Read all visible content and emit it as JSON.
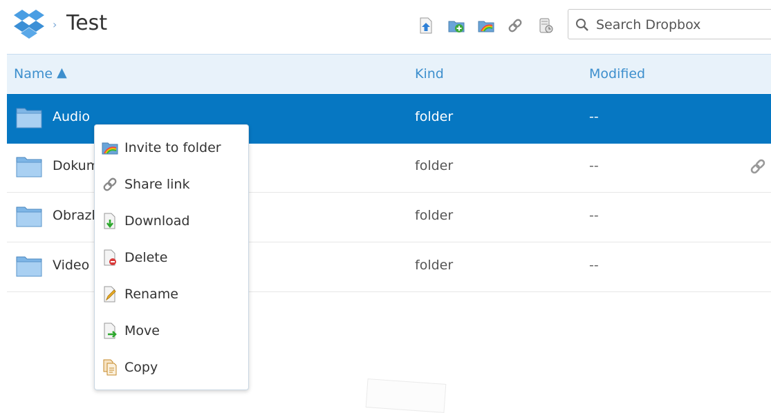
{
  "breadcrumb": {
    "arrow": "›",
    "title": "Test"
  },
  "search": {
    "placeholder": "Search Dropbox"
  },
  "columns": {
    "name": "Name",
    "sort": "▲",
    "kind": "Kind",
    "modified": "Modified"
  },
  "rows": [
    {
      "name": "Audio",
      "kind": "folder",
      "modified": "--"
    },
    {
      "name": "Dokumenty",
      "kind": "folder",
      "modified": "--"
    },
    {
      "name": "Obrazki",
      "kind": "folder",
      "modified": "--"
    },
    {
      "name": "Video",
      "kind": "folder",
      "modified": "--"
    }
  ],
  "context_menu": {
    "items": [
      {
        "label": "Invite to folder",
        "icon": "rainbow-folder-icon"
      },
      {
        "label": "Share link",
        "icon": "link-icon"
      },
      {
        "label": "Download",
        "icon": "download-icon"
      },
      {
        "label": "Delete",
        "icon": "delete-icon"
      },
      {
        "label": "Rename",
        "icon": "rename-icon"
      },
      {
        "label": "Move",
        "icon": "move-icon"
      },
      {
        "label": "Copy",
        "icon": "copy-icon"
      }
    ]
  },
  "colors": {
    "accent": "#0677c2",
    "header_bg": "#e8f2fa",
    "header_text": "#3d8fcd"
  }
}
